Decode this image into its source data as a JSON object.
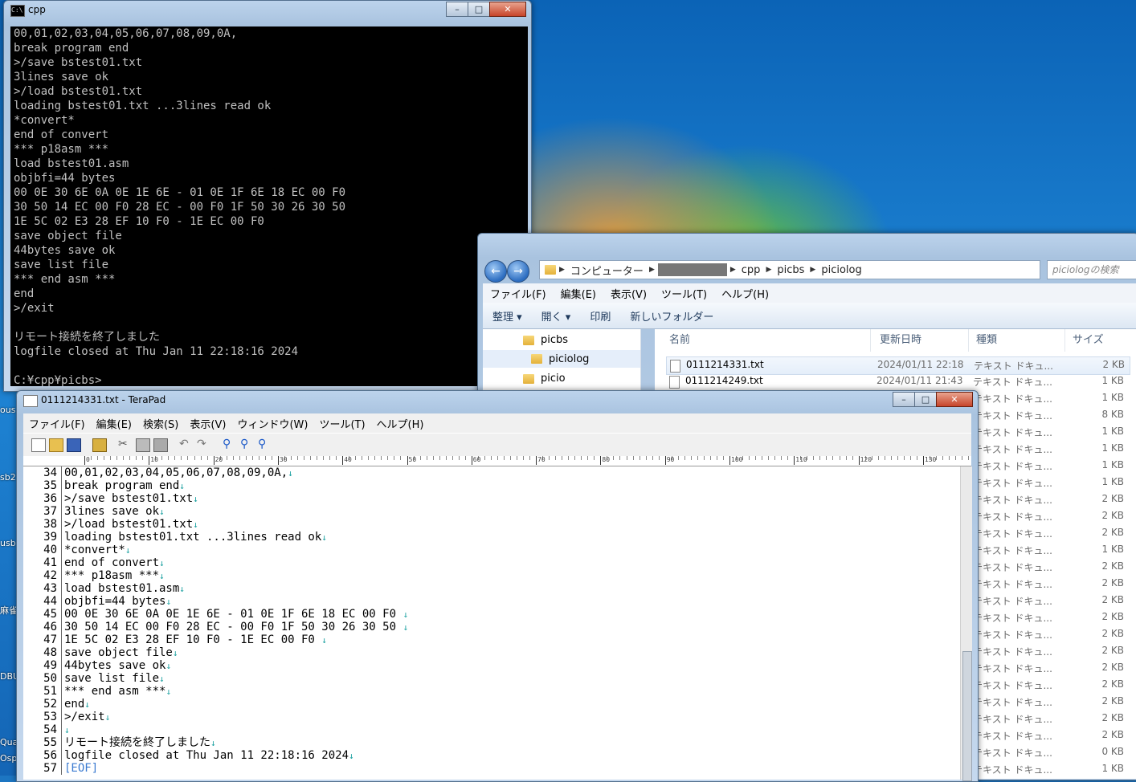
{
  "console": {
    "title": "cpp",
    "lines": [
      "00,01,02,03,04,05,06,07,08,09,0A,",
      "break program end",
      ">/save bstest01.txt",
      "3lines save ok",
      ">/load bstest01.txt",
      "loading bstest01.txt ...3lines read ok",
      "*convert*",
      "end of convert",
      "*** p18asm ***",
      "load bstest01.asm",
      "objbfi=44 bytes",
      "00 0E 30 6E 0A 0E 1E 6E - 01 0E 1F 6E 18 EC 00 F0",
      "30 50 14 EC 00 F0 28 EC - 00 F0 1F 50 30 26 30 50",
      "1E 5C 02 E3 28 EF 10 F0 - 1E EC 00 F0",
      "save object file",
      "44bytes save ok",
      "save list file",
      "*** end asm ***",
      "end",
      ">/exit",
      "",
      "リモート接続を終了しました",
      "logfile closed at Thu Jan 11 22:18:16 2024",
      "",
      "C:¥cpp¥picbs>"
    ]
  },
  "explorer": {
    "breadcrumb": [
      "コンピューター",
      "cpp",
      "picbs",
      "piciolog"
    ],
    "search_placeholder": "piciologの検索",
    "menu": [
      "ファイル(F)",
      "編集(E)",
      "表示(V)",
      "ツール(T)",
      "ヘルプ(H)"
    ],
    "commands": [
      "整理 ▾",
      "開く ▾",
      "印刷",
      "新しいフォルダー"
    ],
    "nav_items": [
      "picbs",
      "piciolog",
      "picio"
    ],
    "columns": [
      "名前",
      "更新日時",
      "種類",
      "サイズ"
    ],
    "files": [
      {
        "name": "0111214331.txt",
        "date": "2024/01/11 22:18",
        "type": "テキスト ドキュ...",
        "size": "2 KB"
      },
      {
        "name": "0111214249.txt",
        "date": "2024/01/11 21:43",
        "type": "テキスト ドキュ...",
        "size": "1 KB"
      },
      {
        "name": "",
        "date": "",
        "type": "テキスト ドキュ...",
        "size": "1 KB"
      },
      {
        "name": "",
        "date": "",
        "type": "テキスト ドキュ...",
        "size": "8 KB"
      },
      {
        "name": "",
        "date": "",
        "type": "テキスト ドキュ...",
        "size": "1 KB"
      },
      {
        "name": "",
        "date": "",
        "type": "テキスト ドキュ...",
        "size": "1 KB"
      },
      {
        "name": "",
        "date": "",
        "type": "テキスト ドキュ...",
        "size": "1 KB"
      },
      {
        "name": "",
        "date": "",
        "type": "テキスト ドキュ...",
        "size": "1 KB"
      },
      {
        "name": "",
        "date": "",
        "type": "テキスト ドキュ...",
        "size": "2 KB"
      },
      {
        "name": "",
        "date": "",
        "type": "テキスト ドキュ...",
        "size": "2 KB"
      },
      {
        "name": "",
        "date": "",
        "type": "テキスト ドキュ...",
        "size": "2 KB"
      },
      {
        "name": "",
        "date": "",
        "type": "テキスト ドキュ...",
        "size": "1 KB"
      },
      {
        "name": "",
        "date": "",
        "type": "テキスト ドキュ...",
        "size": "2 KB"
      },
      {
        "name": "",
        "date": "",
        "type": "テキスト ドキュ...",
        "size": "2 KB"
      },
      {
        "name": "",
        "date": "",
        "type": "テキスト ドキュ...",
        "size": "2 KB"
      },
      {
        "name": "",
        "date": "",
        "type": "テキスト ドキュ...",
        "size": "2 KB"
      },
      {
        "name": "",
        "date": "",
        "type": "テキスト ドキュ...",
        "size": "2 KB"
      },
      {
        "name": "",
        "date": "",
        "type": "テキスト ドキュ...",
        "size": "2 KB"
      },
      {
        "name": "",
        "date": "",
        "type": "テキスト ドキュ...",
        "size": "2 KB"
      },
      {
        "name": "",
        "date": "",
        "type": "テキスト ドキュ...",
        "size": "2 KB"
      },
      {
        "name": "",
        "date": "",
        "type": "テキスト ドキュ...",
        "size": "2 KB"
      },
      {
        "name": "",
        "date": "",
        "type": "テキスト ドキュ...",
        "size": "2 KB"
      },
      {
        "name": "",
        "date": "",
        "type": "テキスト ドキュ...",
        "size": "2 KB"
      },
      {
        "name": "",
        "date": "",
        "type": "テキスト ドキュ...",
        "size": "0 KB"
      },
      {
        "name": "",
        "date": "",
        "type": "テキスト ドキュ...",
        "size": "1 KB"
      }
    ]
  },
  "terapad": {
    "title": "0111214331.txt - TeraPad",
    "menu": [
      "ファイル(F)",
      "編集(E)",
      "検索(S)",
      "表示(V)",
      "ウィンドウ(W)",
      "ツール(T)",
      "ヘルプ(H)"
    ],
    "ruler_labels": [
      "0",
      "10",
      "20",
      "30",
      "40",
      "50",
      "60",
      "70",
      "80",
      "90",
      "100",
      "110",
      "120",
      "130"
    ],
    "lines": [
      {
        "n": "34",
        "t": "00,01,02,03,04,05,06,07,08,09,0A,"
      },
      {
        "n": "35",
        "t": "break program end"
      },
      {
        "n": "36",
        "t": ">/save bstest01.txt"
      },
      {
        "n": "37",
        "t": "3lines save ok"
      },
      {
        "n": "38",
        "t": ">/load bstest01.txt"
      },
      {
        "n": "39",
        "t": "loading bstest01.txt ...3lines read ok"
      },
      {
        "n": "40",
        "t": "*convert*"
      },
      {
        "n": "41",
        "t": "end of convert"
      },
      {
        "n": "42",
        "t": "*** p18asm ***"
      },
      {
        "n": "43",
        "t": "load bstest01.asm"
      },
      {
        "n": "44",
        "t": "objbfi=44 bytes"
      },
      {
        "n": "45",
        "t": "00 0E 30 6E 0A 0E 1E 6E - 01 0E 1F 6E 18 EC 00 F0 "
      },
      {
        "n": "46",
        "t": "30 50 14 EC 00 F0 28 EC - 00 F0 1F 50 30 26 30 50 "
      },
      {
        "n": "47",
        "t": "1E 5C 02 E3 28 EF 10 F0 - 1E EC 00 F0 "
      },
      {
        "n": "48",
        "t": "save object file"
      },
      {
        "n": "49",
        "t": "44bytes save ok"
      },
      {
        "n": "50",
        "t": "save list file"
      },
      {
        "n": "51",
        "t": "*** end asm ***"
      },
      {
        "n": "52",
        "t": "end"
      },
      {
        "n": "53",
        "t": ">/exit"
      },
      {
        "n": "54",
        "t": ""
      },
      {
        "n": "55",
        "t": "リモート接続を終了しました"
      },
      {
        "n": "56",
        "t": "logfile closed at Thu Jan 11 22:18:16 2024"
      },
      {
        "n": "57",
        "t": "[EOF]",
        "eof": true
      }
    ],
    "crlf_mark": "↓"
  },
  "desktop_icons": [
    "ous",
    "sb2",
    "usb",
    "麻雀",
    "DBU",
    "Qua",
    "Osp"
  ],
  "colors": {
    "console_bg": "#000000",
    "console_fg": "#c0c0c0",
    "crlf": "#1aa0a0",
    "eof": "#3a7ad0"
  }
}
